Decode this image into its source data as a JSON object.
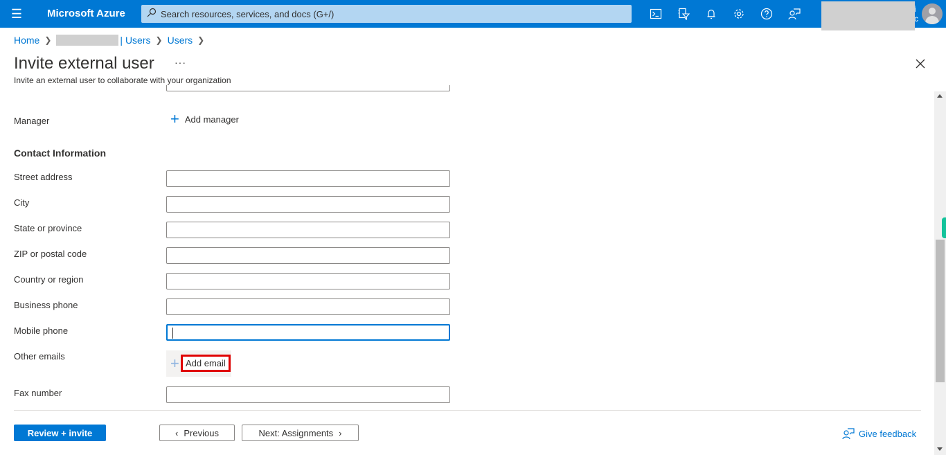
{
  "topbar": {
    "brand": "Microsoft Azure",
    "search_placeholder": "Search resources, services, and docs (G+/)",
    "icons": [
      "cloud-shell-icon",
      "directory-filter-icon",
      "notifications-icon",
      "settings-icon",
      "help-icon",
      "feedback-icon"
    ],
    "account_text_line1": "i",
    "account_text_line2": "c"
  },
  "breadcrumb": {
    "home": "Home",
    "tenant_users": "| Users",
    "users": "Users"
  },
  "page": {
    "title": "Invite external user",
    "more": "···",
    "subtitle": "Invite an external user to collaborate with your organization"
  },
  "form": {
    "manager_label": "Manager",
    "add_manager": "Add manager",
    "contact_section": "Contact Information",
    "fields": [
      {
        "label": "Street address",
        "value": ""
      },
      {
        "label": "City",
        "value": ""
      },
      {
        "label": "State or province",
        "value": ""
      },
      {
        "label": "ZIP or postal code",
        "value": ""
      },
      {
        "label": "Country or region",
        "value": ""
      },
      {
        "label": "Business phone",
        "value": ""
      },
      {
        "label": "Mobile phone",
        "value": ""
      }
    ],
    "other_emails_label": "Other emails",
    "add_email": "Add email",
    "fax_label": "Fax number",
    "fax_value": ""
  },
  "footer": {
    "review_invite": "Review + invite",
    "previous": "Previous",
    "next": "Next: Assignments",
    "give_feedback": "Give feedback"
  },
  "colors": {
    "accent": "#0078d4",
    "highlight": "#e00000"
  }
}
